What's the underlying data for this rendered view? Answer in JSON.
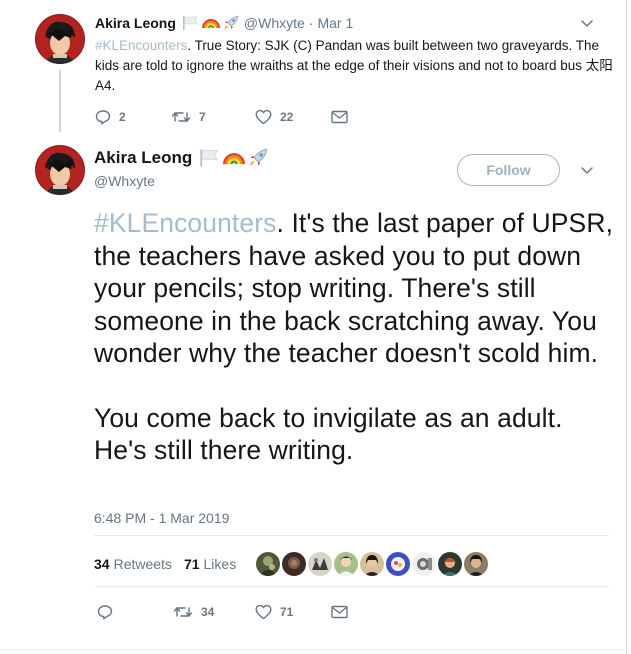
{
  "parent_tweet": {
    "display_name": "Akira Leong",
    "handle": "@Whxyte",
    "separator": "·",
    "date": "Mar 1",
    "hashtag": "#KLEncounters",
    "body": ". True Story: SJK (C) Pandan was built between two graveyards. The kids are told to ignore the wraiths at the edge of their visions and not to board bus 太阳A4.",
    "reply_count": "2",
    "retweet_count": "7",
    "like_count": "22",
    "name_emojis": [
      "white-flag-icon",
      "rainbow-icon",
      "rocket-icon"
    ]
  },
  "main_tweet": {
    "display_name": "Akira Leong",
    "handle": "@Whxyte",
    "follow_label": "Follow",
    "hashtag": "#KLEncounters",
    "para1": ". It's the last paper of UPSR, the teachers have asked you to put down your pencils; stop writing. There's still someone in the back scratching away. You wonder why the teacher doesn't scold him.",
    "para2": "You come back to invigilate as an adult. He's still there writing.",
    "timestamp": "6:48 PM - 1 Mar 2019",
    "retweets_count": "34",
    "retweets_label": "Retweets",
    "likes_count": "71",
    "likes_label": "Likes",
    "action_retweet_count": "34",
    "action_like_count": "71",
    "liker_avatars": [
      "liker-avatar-1",
      "liker-avatar-2",
      "liker-avatar-3",
      "liker-avatar-4",
      "liker-avatar-5",
      "liker-avatar-6",
      "liker-avatar-7",
      "liker-avatar-8",
      "liker-avatar-9"
    ]
  },
  "colors": {
    "hashtag": "#a9bbc8",
    "secondary_text": "#657786",
    "primary_text": "#14171a",
    "thread_line": "#ccd6dd",
    "divider": "#e6ecf0"
  }
}
